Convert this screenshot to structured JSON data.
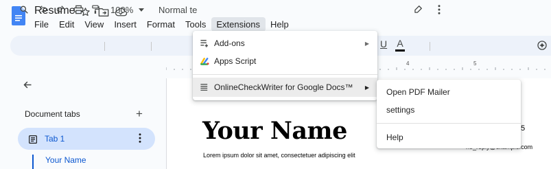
{
  "app": {
    "title": "Resume"
  },
  "menubar": {
    "items": [
      {
        "label": "File"
      },
      {
        "label": "Edit"
      },
      {
        "label": "View"
      },
      {
        "label": "Insert"
      },
      {
        "label": "Format"
      },
      {
        "label": "Tools"
      },
      {
        "label": "Extensions"
      },
      {
        "label": "Help"
      }
    ]
  },
  "toolbar": {
    "zoom": "100%",
    "style": "Normal te",
    "text_color_letter": "A",
    "underline_letter": "U"
  },
  "ruler": {
    "marks": [
      "4",
      "5"
    ]
  },
  "sidebar": {
    "section_label": "Document tabs",
    "add_symbol": "+",
    "tabs": [
      {
        "label": "Tab 1"
      }
    ],
    "outline": [
      {
        "label": "Your Name"
      }
    ]
  },
  "document": {
    "heading": "Your Name",
    "body_line": "Lorem ipsum dolor sit amet, consectetuer adipiscing elit",
    "email_fragment": "no_reply@example.com",
    "trailing_digit": "5"
  },
  "extensions_menu": {
    "items": [
      {
        "label": "Add-ons",
        "icon": "add-ons-icon",
        "has_submenu": true
      },
      {
        "label": "Apps Script",
        "icon": "apps-script-icon",
        "has_submenu": false
      },
      {
        "label": "OnlineCheckWriter for Google Docs™",
        "icon": "addon-list-icon",
        "has_submenu": true
      }
    ]
  },
  "addon_submenu": {
    "items": [
      {
        "label": "Open PDF Mailer"
      },
      {
        "label": "settings"
      },
      {
        "label": "Help"
      }
    ]
  },
  "colors": {
    "accent": "#0b57d0",
    "tab_active_bg": "#d3e3fd",
    "toolbar_bg": "#edf2fa",
    "docs_blue": "#4285f4"
  }
}
